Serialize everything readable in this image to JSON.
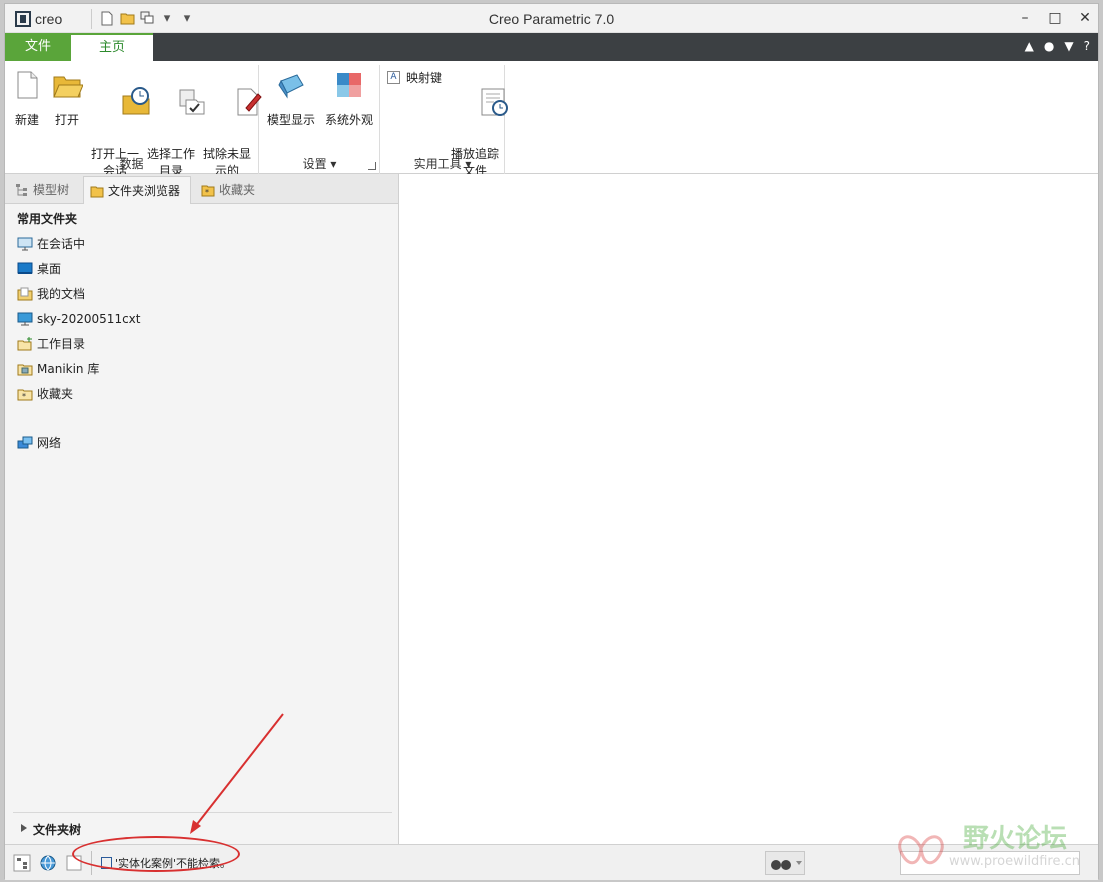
{
  "app": {
    "logo_text": "creo",
    "window_title": "Creo Parametric 7.0"
  },
  "tabs": {
    "file": "文件",
    "home": "主页"
  },
  "ribbon": {
    "data_group": {
      "label": "数据",
      "buttons": [
        {
          "label": "新建",
          "icon": "new-file-icon"
        },
        {
          "label": "打开",
          "icon": "open-folder-icon"
        },
        {
          "label": "打开上一\n会话",
          "icon": "open-last-session-icon"
        },
        {
          "label": "选择工作\n目录",
          "icon": "select-working-dir-icon"
        },
        {
          "label": "拭除未显\n示的",
          "icon": "erase-not-displayed-icon"
        }
      ]
    },
    "settings_group": {
      "label": "设置",
      "buttons": [
        {
          "label": "模型显示",
          "icon": "model-display-icon"
        },
        {
          "label": "系统外观",
          "icon": "system-appearance-icon"
        }
      ]
    },
    "utilities_group": {
      "label": "实用工具",
      "mapkeys_label": "映射键",
      "playback_label": "播放追踪\n文件"
    }
  },
  "navigator": {
    "tabs": [
      "模型树",
      "文件夹浏览器",
      "收藏夹"
    ],
    "section_title": "常用文件夹",
    "items": [
      {
        "label": "在会话中",
        "icon": "in-session-icon"
      },
      {
        "label": "桌面",
        "icon": "desktop-icon"
      },
      {
        "label": "我的文档",
        "icon": "my-documents-icon"
      },
      {
        "label": "sky-20200511cxt",
        "icon": "computer-icon"
      },
      {
        "label": "工作目录",
        "icon": "working-directory-icon"
      },
      {
        "label": "Manikin 库",
        "icon": "manikin-library-icon"
      },
      {
        "label": "收藏夹",
        "icon": "favorites-icon"
      },
      {
        "label": "网络",
        "icon": "network-icon"
      }
    ],
    "folder_tree_label": "文件夹树"
  },
  "status": {
    "message": "'实体化案例'不能检索。"
  },
  "watermark": {
    "title": "野火论坛",
    "url": "www.proewildfire.cn"
  },
  "colors": {
    "file_tab": "#5aa53a",
    "tabstrip": "#3c4043",
    "annotation": "#d83030"
  }
}
